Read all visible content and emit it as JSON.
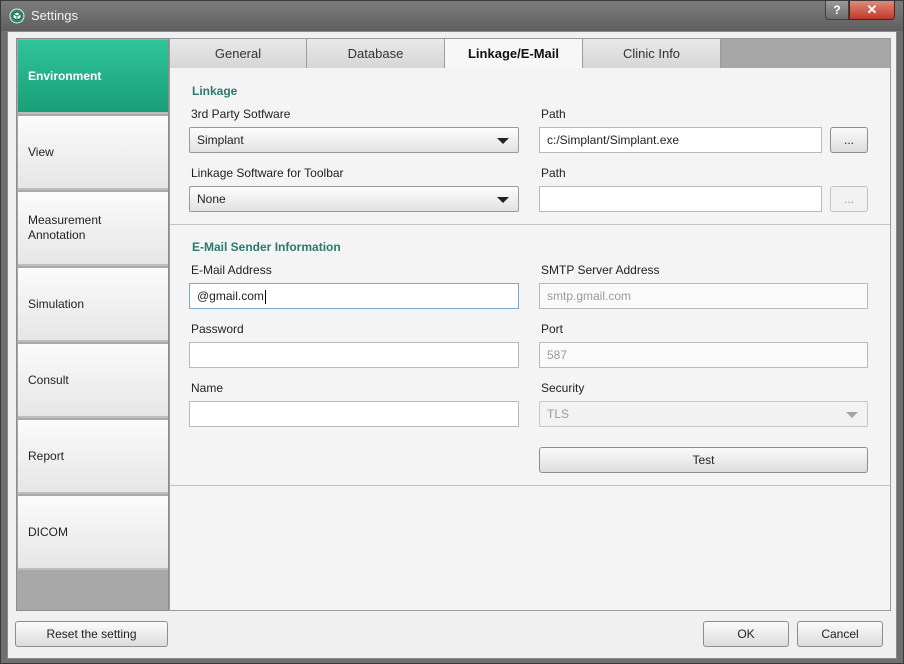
{
  "window": {
    "title": "Settings",
    "help_label": "?",
    "close_label": "✕"
  },
  "sidebar": {
    "items": [
      {
        "label": "Environment",
        "active": true
      },
      {
        "label": "View"
      },
      {
        "label": "Measurement\nAnnotation"
      },
      {
        "label": "Simulation"
      },
      {
        "label": "Consult"
      },
      {
        "label": "Report"
      },
      {
        "label": "DICOM"
      }
    ]
  },
  "tabs": [
    {
      "label": "General"
    },
    {
      "label": "Database"
    },
    {
      "label": "Linkage/E-Mail",
      "active": true
    },
    {
      "label": "Clinic Info"
    }
  ],
  "linkage": {
    "section_title": "Linkage",
    "third_party_label": "3rd Party Sotfware",
    "third_party_value": "Simplant",
    "path1_label": "Path",
    "path1_value": "c:/Simplant/Simplant.exe",
    "browse_label": "...",
    "toolbar_label": "Linkage Software for Toolbar",
    "toolbar_value": "None",
    "path2_label": "Path",
    "path2_value": "",
    "browse2_label": "..."
  },
  "email": {
    "section_title": "E-Mail Sender Information",
    "address_label": "E-Mail Address",
    "address_value": "@gmail.com",
    "smtp_label": "SMTP Server Address",
    "smtp_placeholder": "smtp.gmail.com",
    "password_label": "Password",
    "password_value": "",
    "port_label": "Port",
    "port_placeholder": "587",
    "name_label": "Name",
    "name_value": "",
    "security_label": "Security",
    "security_value": "TLS",
    "test_label": "Test"
  },
  "footer": {
    "reset_label": "Reset the setting",
    "ok_label": "OK",
    "cancel_label": "Cancel"
  },
  "colors": {
    "accent": "#1fae85",
    "section_title": "#2a7a6a"
  }
}
